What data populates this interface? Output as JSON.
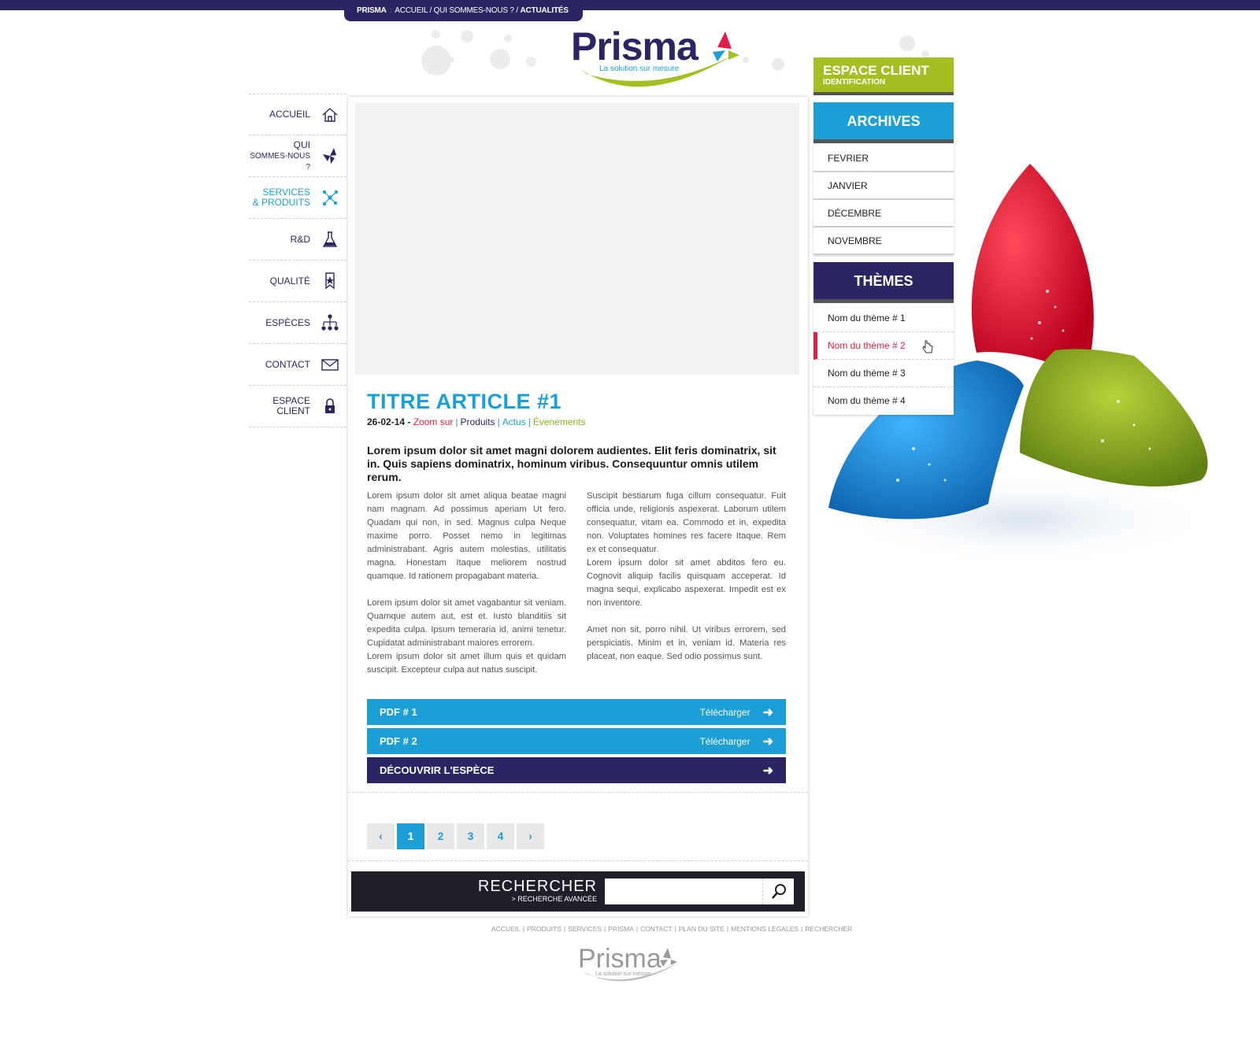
{
  "breadcrumb": {
    "brand": "PRISMA",
    "separator": ":",
    "path": "ACCUEIL / QUI SOMMES-NOUS ? /",
    "current": "ACTUALITÉS"
  },
  "logo": {
    "name": "Prisma",
    "tagline": "La solution sur mesure"
  },
  "nav": [
    {
      "label": "ACCUEIL",
      "icon": "home-icon"
    },
    {
      "label": "QUI",
      "label2": "SOMMES-NOUS ?",
      "icon": "trefoil-icon"
    },
    {
      "label": "SERVICES",
      "label2": "& PRODUITS",
      "icon": "network-icon",
      "active": true
    },
    {
      "label": "R&D",
      "icon": "flask-icon"
    },
    {
      "label": "QUALITÉ",
      "icon": "ribbon-star-icon"
    },
    {
      "label": "ESPÈCES",
      "icon": "hierarchy-icon"
    },
    {
      "label": "CONTACT",
      "icon": "envelope-icon"
    },
    {
      "label": "ESPACE",
      "label2": "CLIENT",
      "icon": "lock-icon"
    }
  ],
  "article": {
    "title": "TITRE ARTICLE #1",
    "date": "26-02-14 -",
    "categories": [
      "Zoom sur",
      "Produits",
      "Actus",
      "Évenements"
    ],
    "lead": "Lorem ipsum dolor sit amet magni dolorem audientes. Elit feris dominatrix, sit in. Quis sapiens dominatrix, hominum viribus. Consequuntur omnis utilem rerum.",
    "col1_p1": "Lorem ipsum dolor sit amet aliqua beatae magni nam magnam. Ad possimus aperiam Ut fero. Quadam qui non, in sed. Magnus culpa Neque maxime porro. Posset nemo in legitimas administrabant. Agris autem molestias, utilitatis magna. Honestam Itaque meliorem nostrud quamque. Id rationem propagabant materia.",
    "col1_p2": "Lorem ipsum dolor sit amet vagabantur sit veniam. Quamque autem aut, est et. Iusto blanditiis sit expedita culpa. Ipsum temeraria id, animi tenetur. Cupidatat administrabant maiores errorem.",
    "col1_p3": "Lorem ipsum dolor sit amet illum quis et quidam suscipit. Excepteur culpa aut natus suscipit.",
    "col2_p1": "Suscipit bestiarum fuga cillum consequatur. Fuit officia unde, religionis aspexerat. Laborum utilem consequatur, vitam ea. Commodo et in, expedita non. Voluptates homines res facere Itaque. Rem ex et consequatur.",
    "col2_p2": "Lorem ipsum dolor sit amet abditos fero eu. Cognovit aliquip facilis quisquam acceperat. Id magna sequi, explicabo aspexerat. Impedit est ex non inventore.",
    "col2_p3": "Amet non sit, porro nihil. Ut viribus errorem, sed perspiciatis. Minim et in, veniam id. Materia res placeat, non eaque. Sed odio possimus sunt."
  },
  "downloads": [
    {
      "label": "PDF # 1",
      "action": "Télécharger"
    },
    {
      "label": "PDF # 2",
      "action": "Télécharger"
    }
  ],
  "discover": {
    "label": "DÉCOUVRIR L'ESPÈCE"
  },
  "pagination": {
    "prev": "‹",
    "pages": [
      "1",
      "2",
      "3",
      "4"
    ],
    "current": "1",
    "next": "›"
  },
  "search": {
    "label": "RECHERCHER",
    "advanced": "> RECHERCHE AVANCÉE",
    "value": "",
    "icon": "search-icon"
  },
  "footer": {
    "links": [
      "ACCUEIL",
      "PRODUITS",
      "SERVICES",
      "PRISMA",
      "CONTACT",
      "PLAN DU SITE",
      "MENTIONS LÉGALES",
      "RECHERCHER"
    ],
    "separator": "|"
  },
  "sidebar": {
    "espace_client": {
      "title": "ESPACE CLIENT",
      "subtitle": "IDENTIFICATION"
    },
    "archives": {
      "title": "ARCHIVES",
      "items": [
        "FEVRIER",
        "JANVIER",
        "DÉCEMBRE",
        "NOVEMBRE"
      ]
    },
    "themes": {
      "title": "THÈMES",
      "items": [
        "Nom du thème # 1",
        "Nom du thème # 2",
        "Nom du thème # 3",
        "Nom du thème # 4"
      ],
      "active_index": 1
    }
  },
  "colors": {
    "navy": "#2b2563",
    "blue": "#1b9fd6",
    "green": "#a5bf22",
    "red": "#e11d48",
    "dark": "#1f1e29"
  }
}
